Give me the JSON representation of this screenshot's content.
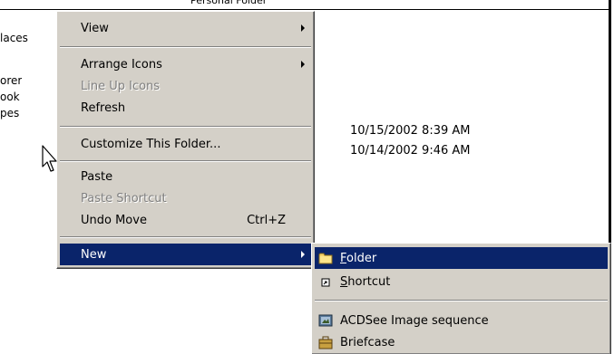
{
  "background": {
    "cut_top_text": "Personal Folder",
    "left_labels": [
      "laces",
      "orer",
      "ook",
      "pes"
    ],
    "dates": [
      "10/15/2002 8:39 AM",
      "10/14/2002 9:46 AM"
    ]
  },
  "context_menu": {
    "items": [
      {
        "label": "View",
        "has_submenu": true
      },
      {
        "label": "Arrange Icons",
        "has_submenu": true
      },
      {
        "label": "Line Up Icons",
        "disabled": true
      },
      {
        "label": "Refresh"
      },
      {
        "label": "Customize This Folder..."
      },
      {
        "label": "Paste"
      },
      {
        "label": "Paste Shortcut",
        "disabled": true
      },
      {
        "label": "Undo Move",
        "accelerator": "Ctrl+Z"
      },
      {
        "label": "New",
        "has_submenu": true,
        "selected": true
      }
    ]
  },
  "new_submenu": {
    "items": [
      {
        "mnemonic": "F",
        "rest": "older",
        "icon": "folder-icon",
        "selected": true
      },
      {
        "mnemonic": "S",
        "rest": "hortcut",
        "icon": "shortcut-icon"
      },
      {
        "label": "ACDSee Image sequence",
        "icon": "acdsee-icon"
      },
      {
        "label": "Briefcase",
        "icon": "briefcase-icon"
      }
    ]
  },
  "colors": {
    "menu_bg": "#d4d0c8",
    "highlight": "#0a246a",
    "highlight_text": "#ffffff",
    "disabled_text": "#808080"
  }
}
